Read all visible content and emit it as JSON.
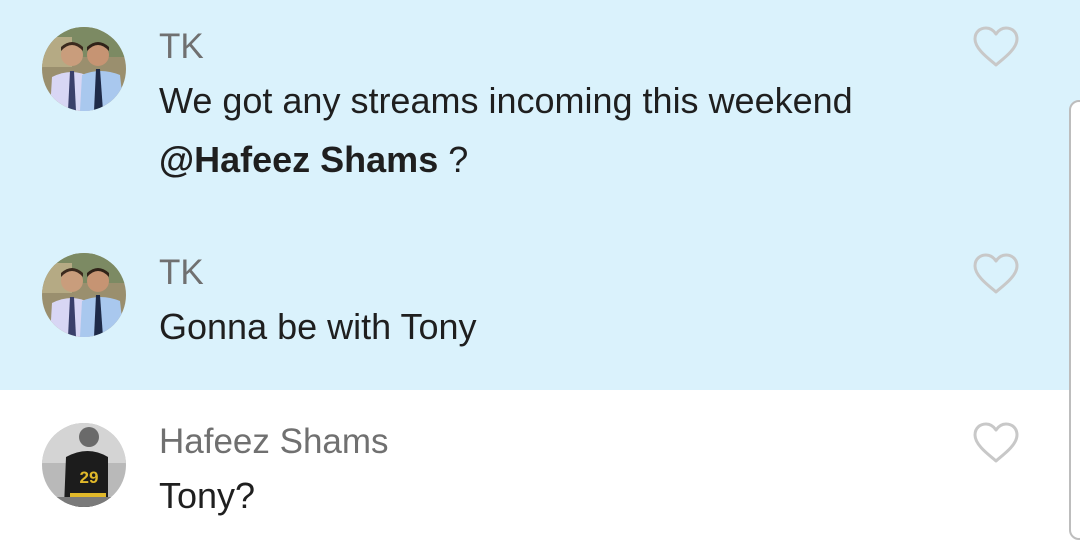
{
  "messages": [
    {
      "author": "TK",
      "text_before": "We got any streams incoming this weekend ",
      "mention": "@Hafeez Shams",
      "text_after": " ?",
      "avatar": "photo-two-men-in-shirts",
      "liked": false
    },
    {
      "author": "TK",
      "text": "Gonna be with Tony",
      "avatar": "photo-two-men-in-shirts",
      "liked": false
    },
    {
      "author": "Hafeez Shams",
      "text": "Tony?",
      "avatar": "photo-player-jersey-29",
      "jersey_number": "29",
      "liked": false
    }
  ],
  "icons": {
    "like": "heart-outline-icon"
  },
  "colors": {
    "highlight_background": "#daf2fc",
    "author_text": "#707070",
    "body_text": "#1f1f1f",
    "heart_outline": "#c8c8c8"
  }
}
